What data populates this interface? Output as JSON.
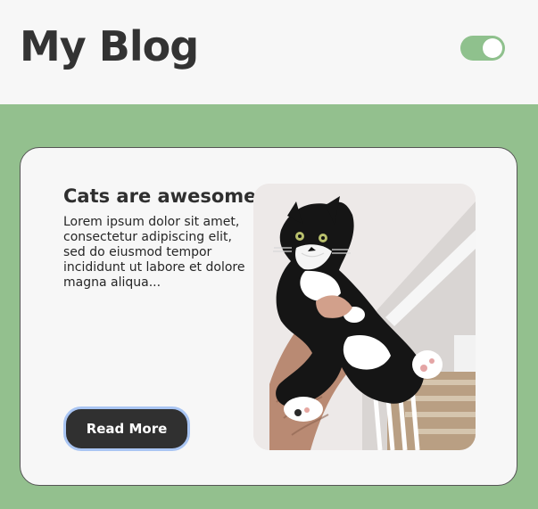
{
  "header": {
    "title": "My Blog",
    "theme_toggle": {
      "state": "on",
      "accent": "#8fc18d"
    }
  },
  "colors": {
    "page_background": "#f7f7f7",
    "content_background": "#93c08e",
    "card_background": "#f7f7f7",
    "button_background": "#303030",
    "button_focus_ring": "#a9c5f3"
  },
  "post": {
    "title": "Cats are awesome",
    "excerpt": "Lorem ipsum dolor sit amet, consectetur adipiscing elit, sed do eiusmod tempor incididunt ut labore et dolore magna aliqua...",
    "read_more_label": "Read More",
    "image": {
      "subject": "black-and-white cat held up by a hand"
    }
  }
}
